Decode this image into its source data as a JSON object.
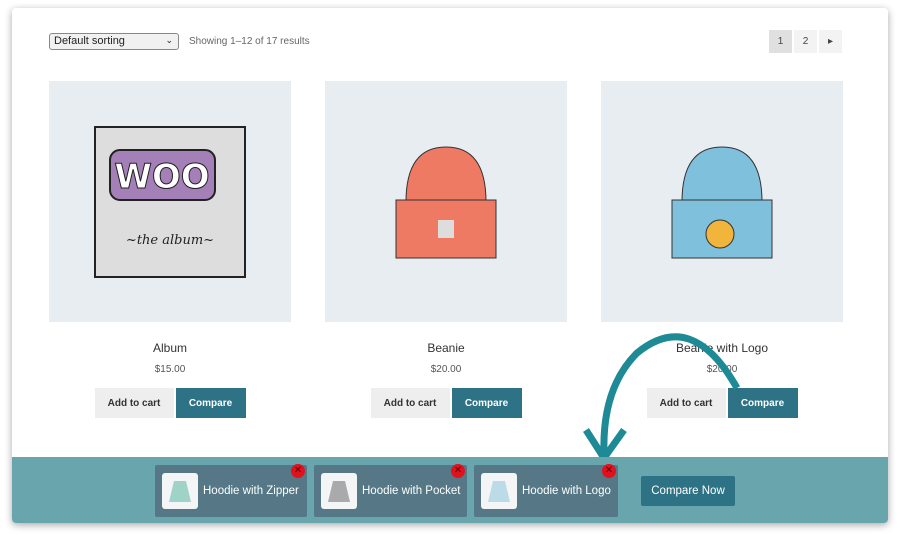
{
  "toolbar": {
    "sort": "Default sorting",
    "count": "Showing 1–12 of 17 results",
    "pages": [
      "1",
      "2"
    ],
    "next": "▸"
  },
  "products": [
    {
      "name": "Album",
      "price": "$15.00",
      "add": "Add to cart",
      "compare": "Compare"
    },
    {
      "name": "Beanie",
      "price": "$20.00",
      "add": "Add to cart",
      "compare": "Compare"
    },
    {
      "name": "Beanie with Logo",
      "price": "$20.00",
      "add": "Add to cart",
      "compare": "Compare"
    }
  ],
  "compare_bar": {
    "items": [
      "Hoodie with Zipper",
      "Hoodie with Pocket",
      "Hoodie with Logo"
    ],
    "remove": "✕",
    "button": "Compare Now"
  },
  "album_art": {
    "logo": "WOO",
    "sub": "the album"
  }
}
